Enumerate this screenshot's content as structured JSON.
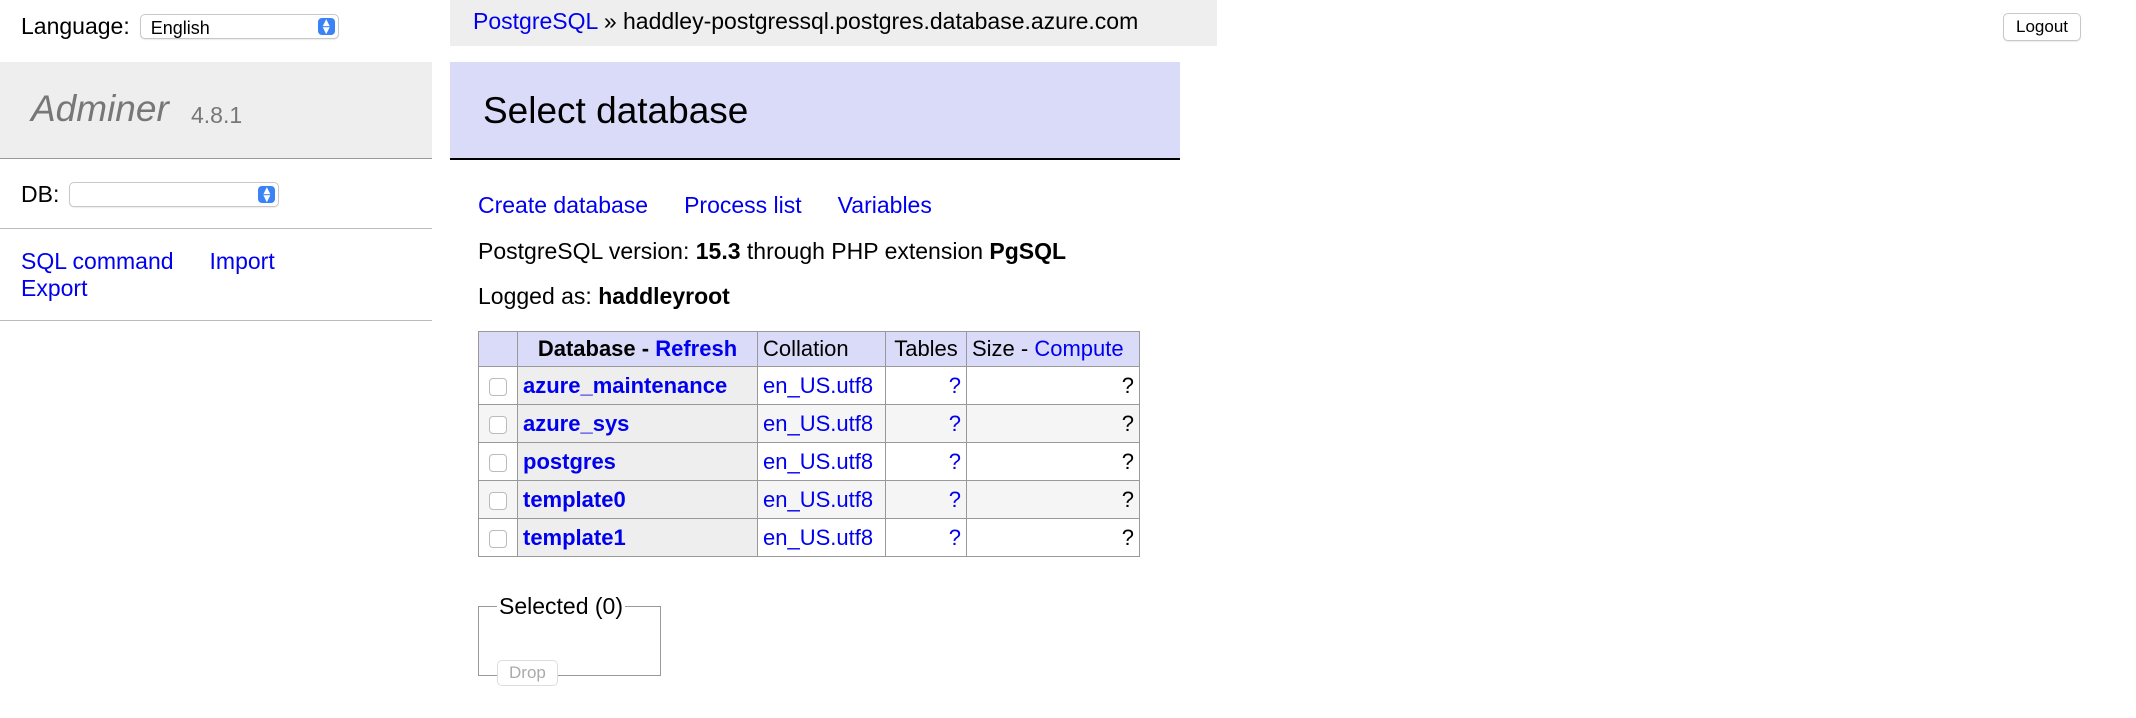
{
  "language": {
    "label": "Language:",
    "value": "English"
  },
  "app": {
    "name": "Adminer",
    "version": "4.8.1"
  },
  "db_select": {
    "label": "DB:",
    "value": ""
  },
  "menu_links": {
    "sql_command": "SQL command",
    "import": "Import",
    "export": "Export"
  },
  "breadcrumb": {
    "driver": "PostgreSQL",
    "separator": "»",
    "server": "haddley-postgressql.postgres.database.azure.com"
  },
  "logout_label": "Logout",
  "page_title": "Select database",
  "actions": {
    "create": "Create database",
    "process": "Process list",
    "variables": "Variables"
  },
  "version_line": {
    "prefix": "PostgreSQL version:",
    "version": "15.3",
    "middle": "through PHP extension",
    "extension": "PgSQL"
  },
  "logged_line": {
    "prefix": "Logged as:",
    "user": "haddleyroot"
  },
  "table": {
    "headers": {
      "database": "Database",
      "dash": " - ",
      "refresh": "Refresh",
      "collation": "Collation",
      "tables": "Tables",
      "size": "Size",
      "size_dash": " - ",
      "compute": "Compute"
    },
    "rows": [
      {
        "name": "azure_maintenance",
        "collation": "en_US.utf8",
        "tables": "?",
        "size": "?"
      },
      {
        "name": "azure_sys",
        "collation": "en_US.utf8",
        "tables": "?",
        "size": "?"
      },
      {
        "name": "postgres",
        "collation": "en_US.utf8",
        "tables": "?",
        "size": "?"
      },
      {
        "name": "template0",
        "collation": "en_US.utf8",
        "tables": "?",
        "size": "?"
      },
      {
        "name": "template1",
        "collation": "en_US.utf8",
        "tables": "?",
        "size": "?"
      }
    ]
  },
  "selected": {
    "legend": "Selected (0)",
    "drop_label": "Drop"
  }
}
